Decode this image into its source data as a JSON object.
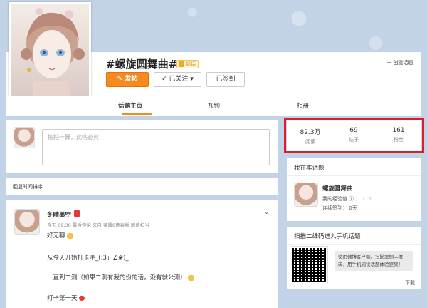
{
  "header": {
    "title": "#螺旋圆舞曲#",
    "host_badge": "超话",
    "post_button": "发帖",
    "follow_button": "已关注",
    "checkin_button": "已签到",
    "create_topic": "创建话题"
  },
  "tabs": [
    {
      "label": "话题主页"
    },
    {
      "label": "视频"
    },
    {
      "label": "相册"
    }
  ],
  "composer": {
    "placeholder": "拍拍一算，此帖必火"
  },
  "sort": {
    "label": "回复时间排序"
  },
  "post": {
    "author": "冬晴墨空",
    "meta": "今天 09:30 最后评论 来自 荣耀8青春版 颜值担当",
    "lines": [
      "好无聊",
      "从今天开始打卡吧_(:3」∠❀)_",
      "一直到二测（如果二测有我的份的话，没有就公测）",
      "打卡第一天"
    ]
  },
  "stats": [
    {
      "value": "82.3万",
      "label": "阅读"
    },
    {
      "value": "69",
      "label": "帖子"
    },
    {
      "value": "161",
      "label": "粉丝"
    }
  ],
  "me_panel": {
    "title": "我在本话题",
    "topic": "螺旋圆舞曲",
    "exp_label": "我的经验值",
    "exp_value": "115",
    "streak_label": "连续签到：",
    "streak_value": "0天"
  },
  "qr_panel": {
    "title": "扫描二维码进入手机话题",
    "description": "使用微博客户端，扫描左侧二维码，用手机阅读话题体验更爽！",
    "download": "下载"
  },
  "colors": {
    "accent": "#f58b1f",
    "highlight": "#d8202a",
    "background": "#c2d3e7"
  }
}
